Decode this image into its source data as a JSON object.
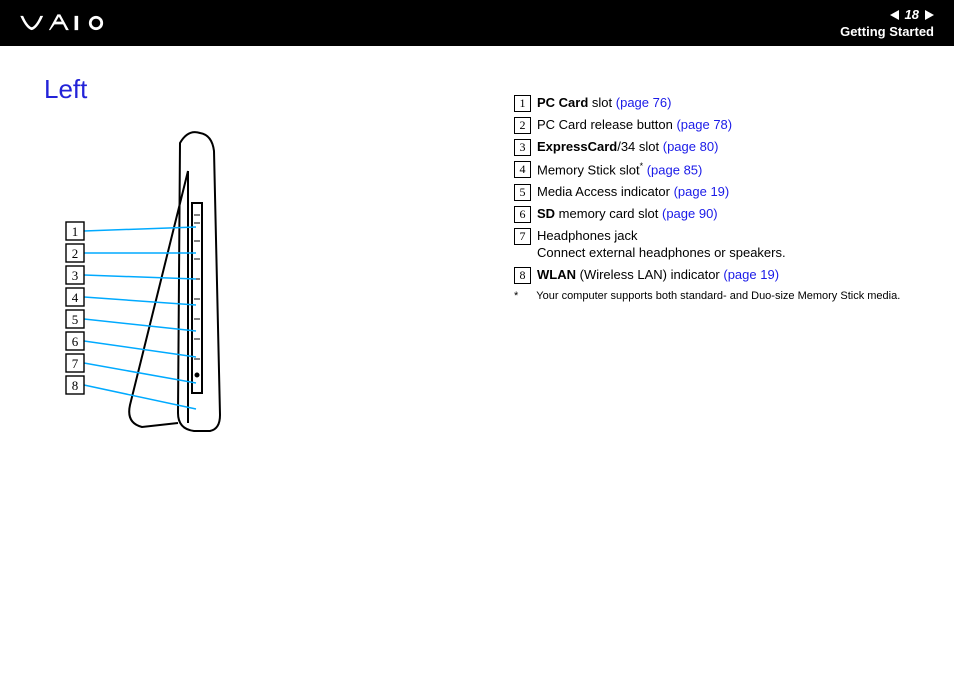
{
  "header": {
    "page_number": "18",
    "section": "Getting Started"
  },
  "title": "Left",
  "items": [
    {
      "num": "1",
      "bold1": "PC Card",
      "text1": " slot ",
      "link": "(page 76)"
    },
    {
      "num": "2",
      "text1": "PC Card release button ",
      "link": "(page 78)"
    },
    {
      "num": "3",
      "bold1": "ExpressCard",
      "text1": "/34 slot ",
      "link": "(page 80)"
    },
    {
      "num": "4",
      "text1": "Memory Stick slot",
      "sup": "*",
      "text2": " ",
      "link": "(page 85)"
    },
    {
      "num": "5",
      "text1": "Media Access indicator ",
      "link": "(page 19)"
    },
    {
      "num": "6",
      "bold1": "SD",
      "text1": " memory card slot ",
      "link": "(page 90)"
    },
    {
      "num": "7",
      "text1": "Headphones jack",
      "text2_block": "Connect external headphones or speakers."
    },
    {
      "num": "8",
      "bold1": "WLAN",
      "text1": " (Wireless LAN) indicator ",
      "link": "(page 19)"
    }
  ],
  "footnote": {
    "marker": "*",
    "text": "Your computer supports both standard- and Duo-size Memory Stick media."
  },
  "callouts": [
    "1",
    "2",
    "3",
    "4",
    "5",
    "6",
    "7",
    "8"
  ]
}
